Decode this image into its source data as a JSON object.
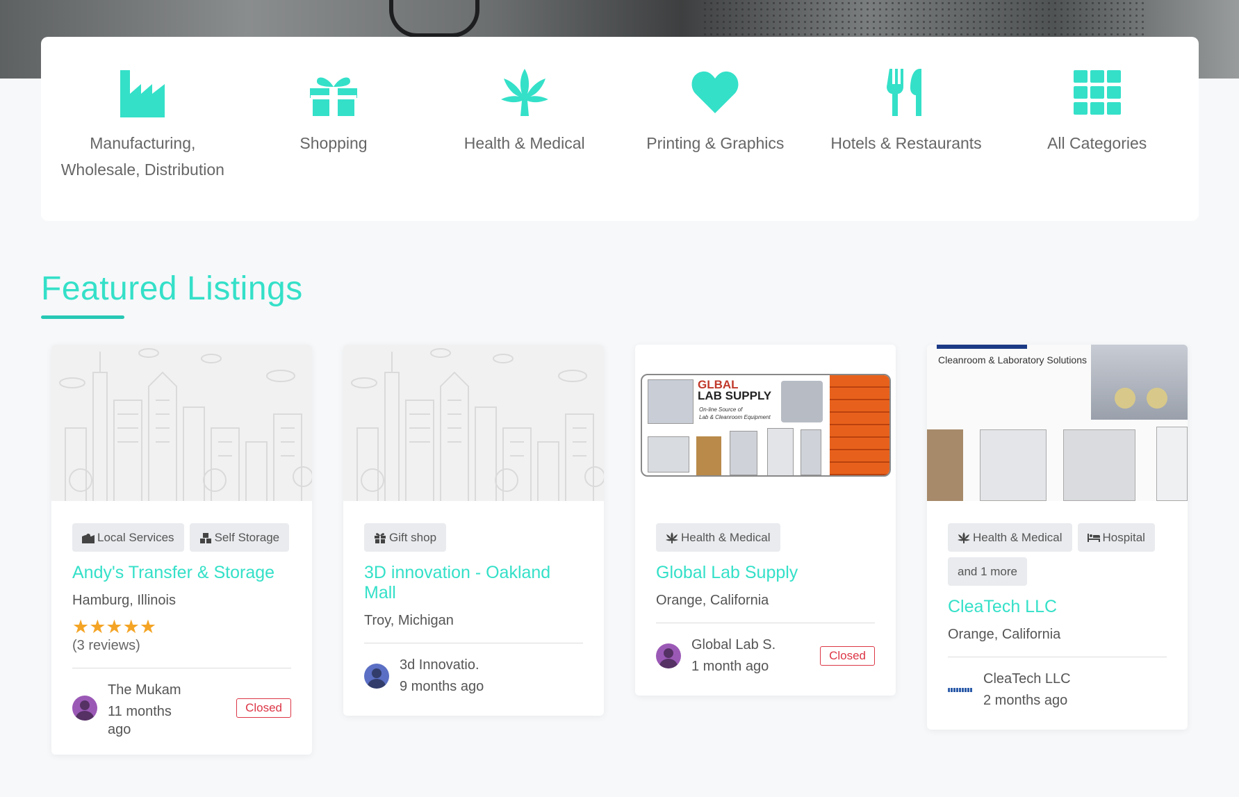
{
  "colors": {
    "accent": "#34e0c8",
    "closed": "#dc3545",
    "star": "#f4a425"
  },
  "categories": [
    {
      "label": "Manufacturing, Wholesale, Distribution",
      "icon": "factory-icon"
    },
    {
      "label": "Shopping",
      "icon": "gift-icon"
    },
    {
      "label": "Health & Medical",
      "icon": "cannabis-leaf-icon"
    },
    {
      "label": "Printing & Graphics",
      "icon": "heart-icon"
    },
    {
      "label": "Hotels & Restaurants",
      "icon": "utensils-icon"
    },
    {
      "label": "All Categories",
      "icon": "grid-icon"
    }
  ],
  "featured": {
    "title": "Featured Listings",
    "listings": [
      {
        "tags": [
          {
            "label": "Local Services",
            "icon": "map-marker-icon"
          },
          {
            "label": "Self Storage",
            "icon": "boxes-icon"
          }
        ],
        "title": "Andy's Transfer & Storage",
        "location": "Hamburg, Illinois",
        "stars": "★★★★★",
        "rating": 5,
        "reviews": "(3 reviews)",
        "author": "The Mukam",
        "time_line1": "11 months",
        "time_line2": "ago",
        "status": "Closed"
      },
      {
        "tags": [
          {
            "label": "Gift shop",
            "icon": "gift-icon"
          }
        ],
        "title": "3D innovation - Oakland Mall",
        "location": "Troy, Michigan",
        "author": "3d Innovatio.",
        "time": "9 months ago"
      },
      {
        "tags": [
          {
            "label": "Health & Medical",
            "icon": "cannabis-leaf-icon"
          }
        ],
        "title": "Global Lab Supply",
        "location": "Orange, California",
        "author": "Global Lab S.",
        "time": "1 month ago",
        "status": "Closed",
        "image_text": {
          "brand1": "GL",
          "brand2": "BAL",
          "brand3": "LAB SUPPLY",
          "tagline1": "On-line Source of",
          "tagline2": "Lab & Cleanroom Equipment"
        }
      },
      {
        "tags": [
          {
            "label": "Health & Medical",
            "icon": "cannabis-leaf-icon"
          },
          {
            "label": "Hospital",
            "icon": "bed-icon"
          },
          {
            "label": "and 1 more"
          }
        ],
        "title": "CleaTech LLC",
        "location": "Orange, California",
        "author": "CleaTech LLC",
        "time": "2 months ago",
        "image_text": {
          "tagline": "Cleanroom & Laboratory Solutions"
        }
      }
    ]
  }
}
